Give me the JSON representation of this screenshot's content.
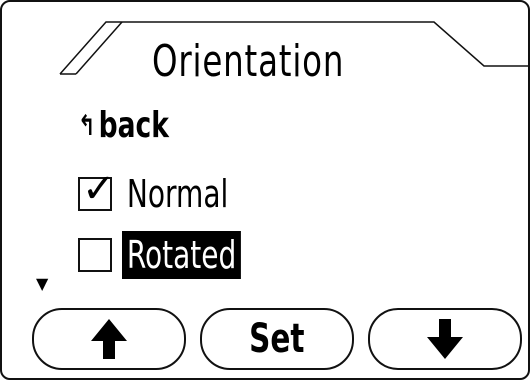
{
  "screen": {
    "title": "Orientation",
    "back_label": "back",
    "back_icon": "return-arrow-icon",
    "options": [
      {
        "label": "Normal",
        "checked": true,
        "selected": false
      },
      {
        "label": "Rotated",
        "checked": false,
        "selected": true
      }
    ],
    "check_glyph": "✓",
    "scroll_indicator": "▼"
  },
  "softkeys": {
    "up_icon": "arrow-up-icon",
    "set_label": "Set",
    "down_icon": "arrow-down-icon"
  }
}
